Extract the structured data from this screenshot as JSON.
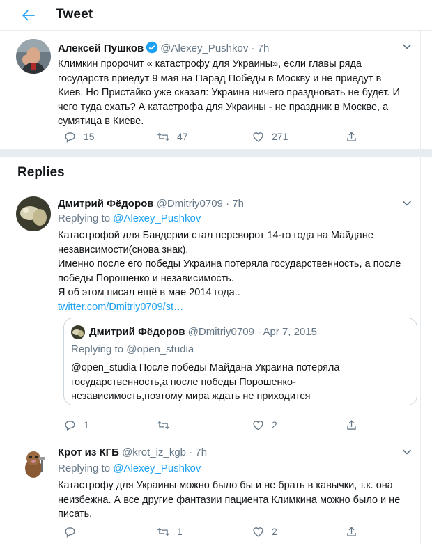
{
  "header": {
    "title": "Tweet",
    "back_icon": "arrow-left-icon"
  },
  "main_tweet": {
    "author_name": "Алексей Пушков",
    "handle": "@Alexey_Pushkov",
    "time": "· 7h",
    "verified": true,
    "body_lines": [
      "Климкин пророчит « катастрофу для Украины», если главы ряда",
      "государств приедут 9 мая на Парад Победы в Москву и не приедут в",
      "Киев. Но Пристайко уже сказал: Украина ничего праздновать не будет. И",
      "чего туда ехать? А катастрофа для Украины - не праздник в Москве, а",
      "сумятица в Киеве."
    ],
    "stats": {
      "replies": "15",
      "retweets": "47",
      "likes": "271"
    }
  },
  "replies_title": "Replies",
  "reply1": {
    "author_name": "Дмитрий Фёдоров",
    "handle": "@Dmitriy0709",
    "time": "· 7h",
    "replying_prefix": "Replying to ",
    "replying_handle": "@Alexey_Pushkov",
    "body_lines": [
      "Катастрофой для Бандерии стал переворот 14-го года на Майдане",
      "независимости(снова знак).",
      "Именно после его победы Украина потеряла государственность, а после",
      "победы Порошенко и независимость.",
      "Я об этом писал ещё в мае 2014 года.."
    ],
    "link": "twitter.com/Dmitriy0709/st…",
    "quote": {
      "author_name": "Дмитрий Фёдоров",
      "handle": "@Dmitriy0709",
      "time": "· Apr 7, 2015",
      "replying": "Replying to @open_studia",
      "body_lines": [
        "@open_studia После победы Майдана Украина потеряла",
        "государственность,а после победы Порошенко-",
        "независимость,поэтому мира ждать не приходится"
      ]
    },
    "stats": {
      "replies": "1",
      "retweets": "",
      "likes": "2"
    }
  },
  "reply2": {
    "author_name": "Крот из КГБ",
    "handle": "@krot_iz_kgb",
    "time": "· 7h",
    "replying_prefix": "Replying to ",
    "replying_handle": "@Alexey_Pushkov",
    "body_lines": [
      "Катастрофу для Украины можно было бы и не брать в кавычки, т.к. она",
      "неизбежна. А все другие фантазии пациента Климкина можно было и не",
      "писать."
    ],
    "stats": {
      "replies": "",
      "retweets": "1",
      "likes": "2"
    }
  },
  "colors": {
    "accent": "#1da1f2",
    "muted": "#657786",
    "divider": "#e6ecf0",
    "text": "#14171a"
  }
}
